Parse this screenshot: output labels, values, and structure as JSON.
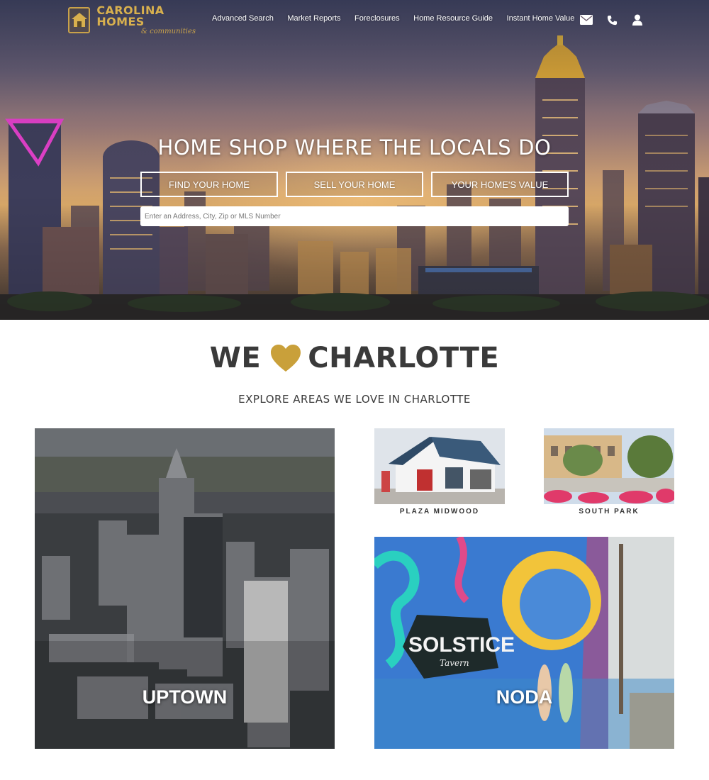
{
  "brand": {
    "name": "CAROLINA HOMES",
    "tagline": "& communities"
  },
  "nav": {
    "links": [
      "Advanced Search",
      "Market Reports",
      "Foreclosures",
      "Home Resource Guide",
      "Instant Home Value"
    ],
    "icons": [
      "envelope-icon",
      "phone-icon",
      "user-icon"
    ]
  },
  "hero": {
    "title": "HOME SHOP WHERE THE LOCALS DO",
    "buttons": [
      "FIND YOUR HOME",
      "SELL YOUR HOME",
      "YOUR HOME'S VALUE"
    ],
    "search_placeholder": "Enter an Address, City, Zip or MLS Number"
  },
  "section": {
    "title_left": "WE",
    "title_right": "CHARLOTTE",
    "heart_color": "#c9a03a",
    "subtitle": "EXPLORE AREAS WE LOVE IN CHARLOTTE"
  },
  "areas": {
    "uptown": "UPTOWN",
    "plaza_midwood": "PLAZA MIDWOOD",
    "south_park": "SOUTH PARK",
    "noda": "NODA",
    "mural_sign": "SOLSTICE",
    "mural_sign_sub": "Tavern"
  },
  "colors": {
    "gold": "#c9a24a",
    "text_dark": "#3a3a3a"
  }
}
